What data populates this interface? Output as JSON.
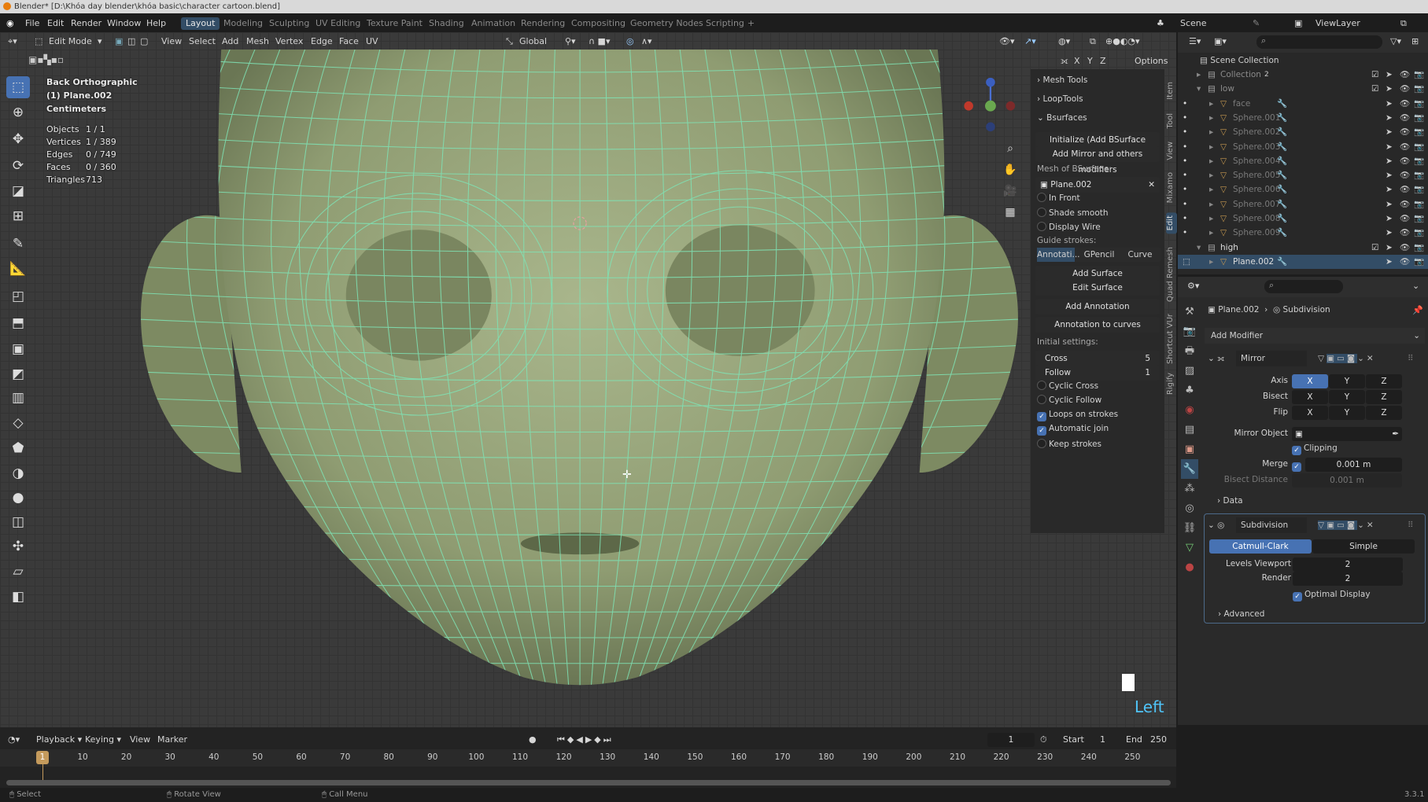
{
  "window": {
    "title": "Blender* [D:\\Khóa day blender\\khóa basic\\character cartoon.blend]"
  },
  "menu": {
    "items": [
      "File",
      "Edit",
      "Render",
      "Window",
      "Help"
    ],
    "workspaces": [
      "Layout",
      "Modeling",
      "Sculpting",
      "UV Editing",
      "Texture Paint",
      "Shading",
      "Animation",
      "Rendering",
      "Compositing",
      "Geometry Nodes",
      "Scripting"
    ],
    "active_workspace": "Layout",
    "add_tab": "+",
    "scene": "Scene",
    "view_layer": "ViewLayer"
  },
  "viewport_header": {
    "mode": "Edit Mode",
    "menus": [
      "View",
      "Select",
      "Add",
      "Mesh",
      "Vertex",
      "Edge",
      "Face",
      "UV"
    ],
    "orientation": "Global",
    "mirror_axes": [
      "X",
      "Y",
      "Z"
    ],
    "options": "Options"
  },
  "overlay": {
    "view": "Back Orthographic",
    "object": "(1) Plane.002",
    "units": "Centimeters",
    "stats": [
      {
        "label": "Objects",
        "value": "1 / 1"
      },
      {
        "label": "Vertices",
        "value": "1 / 389"
      },
      {
        "label": "Edges",
        "value": "0 / 749"
      },
      {
        "label": "Faces",
        "value": "0 / 360"
      },
      {
        "label": "Triangles",
        "value": "713"
      }
    ],
    "side_label": "Left",
    "accent": "#4fc3f7"
  },
  "npanel": {
    "sections": [
      "Mesh Tools",
      "LoopTools",
      "Bsurfaces"
    ],
    "init_button": "Initialize (Add BSurface mesh)",
    "mirror_button": "Add Mirror and others modifiers",
    "mesh_label": "Mesh of BSurface:",
    "mesh_value": "Plane.002",
    "options1": [
      {
        "label": "In Front",
        "checked": false
      },
      {
        "label": "Shade smooth",
        "checked": false
      },
      {
        "label": "Display Wire",
        "checked": false
      }
    ],
    "guide_label": "Guide strokes:",
    "guide_tabs": [
      "Annotati...",
      "GPencil",
      "Curve"
    ],
    "add_surface": "Add Surface",
    "edit_surface": "Edit Surface",
    "add_annotation": "Add Annotation",
    "annotation_to_curves": "Annotation to curves",
    "initial_label": "Initial settings:",
    "cross_label": "Cross",
    "cross_value": "5",
    "follow_label": "Follow",
    "follow_value": "1",
    "options2": [
      {
        "label": "Cyclic Cross",
        "checked": false
      },
      {
        "label": "Cyclic Follow",
        "checked": false
      },
      {
        "label": "Loops on strokes",
        "checked": true
      },
      {
        "label": "Automatic join",
        "checked": true
      },
      {
        "label": "Keep strokes",
        "checked": false
      }
    ],
    "tabs": [
      "Item",
      "Tool",
      "View",
      "Mixamo",
      "Edit",
      "Quad Remesh",
      "Shortcut VUr",
      "Rigify"
    ],
    "active_tab": "Edit"
  },
  "outliner": {
    "root": "Scene Collection",
    "rows": [
      {
        "name": "Collection",
        "level": 1,
        "badge": "2"
      },
      {
        "name": "low",
        "level": 1
      },
      {
        "name": "face",
        "level": 2
      },
      {
        "name": "Sphere.001",
        "level": 2
      },
      {
        "name": "Sphere.002",
        "level": 2
      },
      {
        "name": "Sphere.003",
        "level": 2
      },
      {
        "name": "Sphere.004",
        "level": 2
      },
      {
        "name": "Sphere.005",
        "level": 2
      },
      {
        "name": "Sphere.006",
        "level": 2
      },
      {
        "name": "Sphere.007",
        "level": 2
      },
      {
        "name": "Sphere.008",
        "level": 2
      },
      {
        "name": "Sphere.009",
        "level": 2
      },
      {
        "name": "high",
        "level": 1
      },
      {
        "name": "Plane.002",
        "level": 2,
        "selected": true
      }
    ]
  },
  "properties": {
    "object": "Plane.002",
    "modifier": "Subdivision",
    "add_modifier": "Add Modifier",
    "mirror": {
      "name": "Mirror",
      "axis_label": "Axis",
      "bisect_label": "Bisect",
      "flip_label": "Flip",
      "xyz": [
        "X",
        "Y",
        "Z"
      ],
      "mirror_object_label": "Mirror Object",
      "clipping": "Clipping",
      "merge_label": "Merge",
      "merge_value": "0.001 m",
      "bisect_distance_label": "Bisect Distance",
      "bisect_distance_value": "0.001 m",
      "data": "Data"
    },
    "subdivision": {
      "name": "Subdivision",
      "types": [
        "Catmull-Clark",
        "Simple"
      ],
      "levels_label": "Levels Viewport",
      "levels_value": "2",
      "render_label": "Render",
      "render_value": "2",
      "optimal": "Optimal Display",
      "advanced": "Advanced"
    }
  },
  "timeline": {
    "menus": [
      "Playback",
      "Keying",
      "View",
      "Marker"
    ],
    "current_frame": "1",
    "start_label": "Start",
    "start": "1",
    "end_label": "End",
    "end": "250",
    "ticks": [
      "10",
      "20",
      "30",
      "40",
      "50",
      "60",
      "70",
      "80",
      "90",
      "100",
      "110",
      "120",
      "130",
      "140",
      "150",
      "160",
      "170",
      "180",
      "190",
      "200",
      "210",
      "220",
      "230",
      "240",
      "250"
    ]
  },
  "status": {
    "items": [
      "Select",
      "Rotate View",
      "Call Menu"
    ],
    "version": "3.3.1"
  }
}
